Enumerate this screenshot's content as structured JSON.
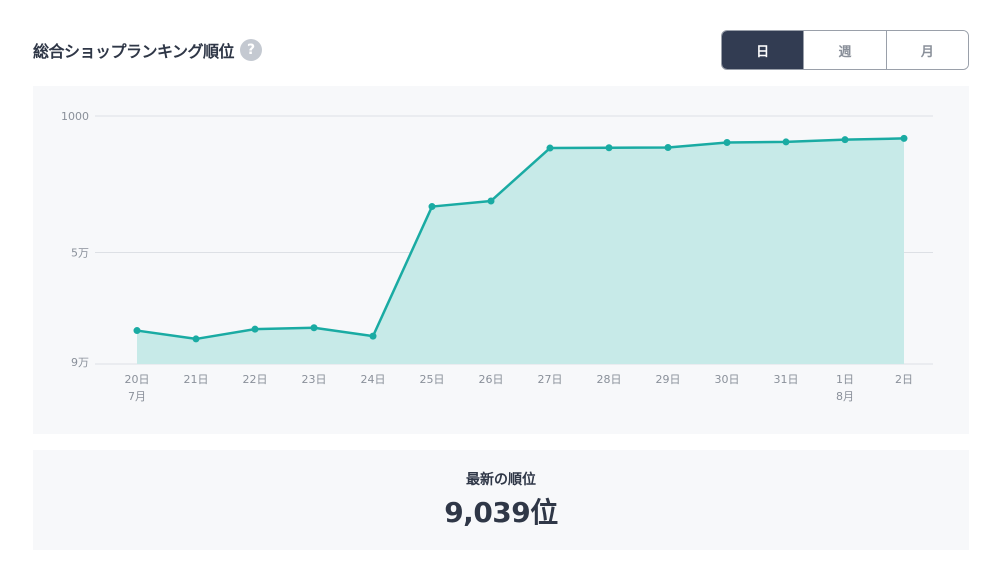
{
  "header": {
    "title": "総合ショップランキング順位",
    "help_symbol": "?"
  },
  "period_tabs": [
    {
      "label": "日",
      "active": true
    },
    {
      "label": "週",
      "active": false
    },
    {
      "label": "月",
      "active": false
    }
  ],
  "colors": {
    "line": "#1aaba3",
    "area": "#c7eae8",
    "grid": "#dde0e5",
    "tick_text": "#8a909a"
  },
  "chart_data": {
    "type": "area",
    "title": "",
    "xlabel": "",
    "ylabel": "",
    "y_axis": {
      "reversed": true,
      "ticks": [
        {
          "value": 1000,
          "label": "1000"
        },
        {
          "value": 50000,
          "label": "5万"
        },
        {
          "value": 90000,
          "label": "9万"
        }
      ],
      "range": [
        1000,
        90000
      ]
    },
    "x_labels": [
      {
        "day": "20日",
        "month": "7月"
      },
      {
        "day": "21日",
        "month": ""
      },
      {
        "day": "22日",
        "month": ""
      },
      {
        "day": "23日",
        "month": ""
      },
      {
        "day": "24日",
        "month": ""
      },
      {
        "day": "25日",
        "month": ""
      },
      {
        "day": "26日",
        "month": ""
      },
      {
        "day": "27日",
        "month": ""
      },
      {
        "day": "28日",
        "month": ""
      },
      {
        "day": "29日",
        "month": ""
      },
      {
        "day": "30日",
        "month": ""
      },
      {
        "day": "31日",
        "month": ""
      },
      {
        "day": "1日",
        "month": "8月"
      },
      {
        "day": "2日",
        "month": ""
      }
    ],
    "series": [
      {
        "values": [
          78000,
          81000,
          77500,
          77000,
          80000,
          33500,
          31500,
          12500,
          12400,
          12300,
          10500,
          10300,
          9500,
          9039
        ]
      }
    ],
    "grid": true,
    "legend": "none"
  },
  "summary": {
    "label": "最新の順位",
    "value": "9,039位"
  }
}
